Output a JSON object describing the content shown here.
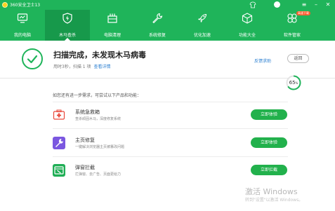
{
  "app": {
    "title": "360安全卫士13",
    "colors": {
      "brand": "#1fb45a",
      "nav_active": "#17994b",
      "link": "#2b7fd1",
      "button": "#22b14c"
    }
  },
  "titlebar_icons": [
    "shirt-icon",
    "avatar",
    "menu-icon",
    "minimize-icon",
    "close-icon"
  ],
  "nav": [
    {
      "label": "我的电脑",
      "icon": "monitor-icon",
      "active": false
    },
    {
      "label": "木马查杀",
      "icon": "shield-icon",
      "active": true
    },
    {
      "label": "电脑清理",
      "icon": "broom-icon",
      "active": false
    },
    {
      "label": "系统修复",
      "icon": "wrench-icon",
      "active": false
    },
    {
      "label": "优化加速",
      "icon": "rocket-icon",
      "active": false
    },
    {
      "label": "功能大全",
      "icon": "grid-icon",
      "active": false
    },
    {
      "label": "软件管家",
      "icon": "clover-icon",
      "active": false,
      "badge": "高速下载"
    }
  ],
  "status": {
    "title": "扫描完成，未发现木马病毒",
    "sub": "用时3秒，扫描 1 项",
    "details_link": "查看详情",
    "feedback": "反馈求助",
    "back": "返回"
  },
  "memory_widget": {
    "value": "65",
    "unit": "%"
  },
  "suggestions": {
    "intro": "如您还有进一步需求，可尝试以下产品和功能：",
    "items": [
      {
        "title": "系统急救箱",
        "desc": "查杀顽固木马，深度修复系统",
        "button": "立即体验",
        "icon": "first-aid-icon",
        "color": "#e9483b"
      },
      {
        "title": "主页修复",
        "desc": "一键解决浏览器主页被篡改问题",
        "button": "立即体验",
        "icon": "wrench-icon",
        "color": "#7b57e0"
      },
      {
        "title": "弹窗拦截",
        "desc": "拦弹窗、去广告、页面更给力",
        "button": "立即拦截",
        "icon": "popup-block-icon",
        "color": "#1fae55"
      }
    ]
  },
  "watermark": {
    "title": "激活 Windows",
    "sub": "转到\"设置\"以激活 Windows。"
  }
}
